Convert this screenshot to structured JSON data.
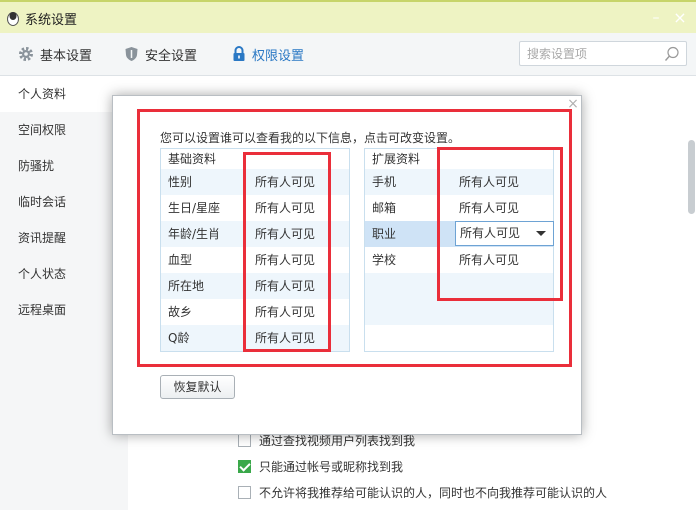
{
  "window": {
    "title": "系统设置",
    "minimize": "–",
    "close": "×"
  },
  "toolbar": {
    "tabs": [
      {
        "label": "基本设置",
        "icon": "gear-icon"
      },
      {
        "label": "安全设置",
        "icon": "shield-icon"
      },
      {
        "label": "权限设置",
        "icon": "lock-icon",
        "active": true
      }
    ],
    "search_placeholder": "搜索设置项"
  },
  "sidebar": {
    "items": [
      {
        "label": "个人资料",
        "active": true
      },
      {
        "label": "空间权限"
      },
      {
        "label": "防骚扰"
      },
      {
        "label": "临时会话"
      },
      {
        "label": "资讯提醒"
      },
      {
        "label": "个人状态"
      },
      {
        "label": "远程桌面"
      }
    ]
  },
  "background_options": [
    {
      "label": "通过查找视频用户列表找到我",
      "checked": false
    },
    {
      "label": "只能通过帐号或昵称找到我",
      "checked": true
    },
    {
      "label": "不允许将我推荐给可能认识的人，同时也不向我推荐可能认识的人",
      "checked": false
    }
  ],
  "dialog": {
    "close": "×",
    "intro": "您可以设置谁可以查看我的以下信息，点击可改变设置。",
    "basic": {
      "header": "基础资料",
      "rows": [
        {
          "field": "性别",
          "value": "所有人可见"
        },
        {
          "field": "生日/星座",
          "value": "所有人可见"
        },
        {
          "field": "年龄/生肖",
          "value": "所有人可见"
        },
        {
          "field": "血型",
          "value": "所有人可见"
        },
        {
          "field": "所在地",
          "value": "所有人可见"
        },
        {
          "field": "故乡",
          "value": "所有人可见"
        },
        {
          "field": "Q龄",
          "value": "所有人可见"
        }
      ]
    },
    "extended": {
      "header": "扩展资料",
      "rows": [
        {
          "field": "手机",
          "value": "所有人可见"
        },
        {
          "field": "邮箱",
          "value": "所有人可见"
        },
        {
          "field": "职业",
          "value": "所有人可见",
          "editing": true
        },
        {
          "field": "学校",
          "value": "所有人可见"
        }
      ]
    },
    "restore_button": "恢复默认"
  },
  "colors": {
    "accent": "#2a78c4",
    "highlight": "#ea2e3a",
    "titlebar": "#eef3c3",
    "checked": "#3aa84a"
  }
}
